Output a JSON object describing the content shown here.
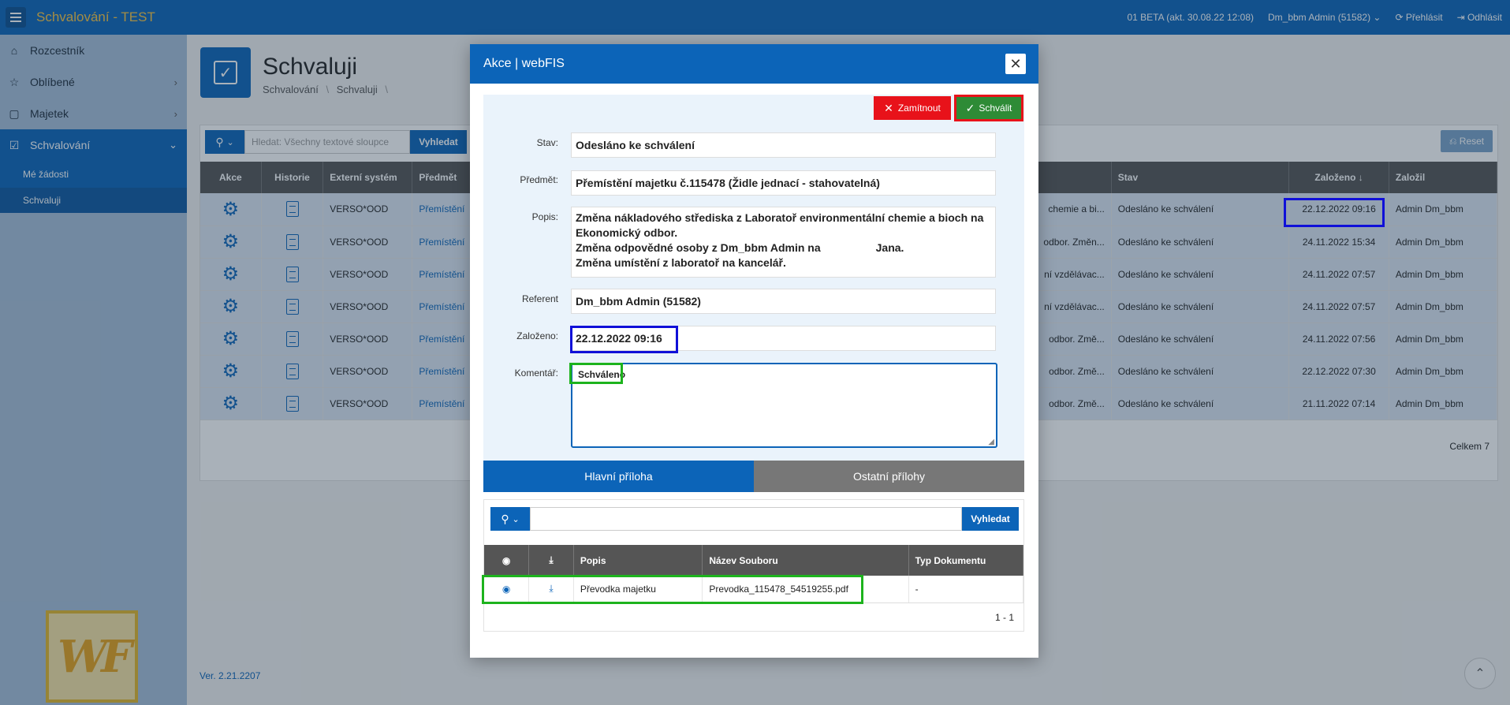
{
  "app": {
    "title": "Schvalování - TEST",
    "version_info": "01 BETA (akt. 30.08.22 12:08)",
    "user": "Dm_bbm Admin (51582)",
    "relogin": "Přehlásit",
    "logout": "Odhlásit"
  },
  "sidebar": {
    "items": [
      {
        "label": "Rozcestník",
        "icon": "home-icon"
      },
      {
        "label": "Oblíbené",
        "icon": "star-icon"
      },
      {
        "label": "Majetek",
        "icon": "box-icon"
      },
      {
        "label": "Schvalování",
        "icon": "checkbox-icon"
      }
    ],
    "subitems": [
      {
        "label": "Mé žádosti"
      },
      {
        "label": "Schvaluji"
      }
    ]
  },
  "page": {
    "title": "Schvaluji",
    "crumb1": "Schvalování",
    "crumb2": "Schvaluji",
    "sep": "\\"
  },
  "report": {
    "search_placeholder": "Hledat: Všechny textové sloupce",
    "search_button": "Vyhledat",
    "reset": "Reset",
    "columns": {
      "akce": "Akce",
      "historie": "Historie",
      "externi": "Externí systém",
      "predmet": "Předmět",
      "stav": "Stav",
      "zalozeno": "Založeno",
      "zalozil": "Založil"
    },
    "rows": [
      {
        "ext": "VERSO*OOD",
        "predmet": "Přemístění",
        "popis": "chemie a bi...",
        "stav": "Odesláno ke schválení",
        "datum": "22.12.2022 09:16",
        "autor": "Admin Dm_bbm"
      },
      {
        "ext": "VERSO*OOD",
        "predmet": "Přemístění",
        "popis": "odbor. Změn...",
        "stav": "Odesláno ke schválení",
        "datum": "24.11.2022 15:34",
        "autor": "Admin Dm_bbm"
      },
      {
        "ext": "VERSO*OOD",
        "predmet": "Přemístění",
        "popis": "ní vzdělávac...",
        "stav": "Odesláno ke schválení",
        "datum": "24.11.2022 07:57",
        "autor": "Admin Dm_bbm"
      },
      {
        "ext": "VERSO*OOD",
        "predmet": "Přemístění",
        "popis": "ní vzdělávac...",
        "stav": "Odesláno ke schválení",
        "datum": "24.11.2022 07:57",
        "autor": "Admin Dm_bbm"
      },
      {
        "ext": "VERSO*OOD",
        "predmet": "Přemístění",
        "popis": "odbor. Změ...",
        "stav": "Odesláno ke schválení",
        "datum": "24.11.2022 07:56",
        "autor": "Admin Dm_bbm"
      },
      {
        "ext": "VERSO*OOD",
        "predmet": "Přemístění",
        "popis": "odbor. Změ...",
        "stav": "Odesláno ke schválení",
        "datum": "22.12.2022 07:30",
        "autor": "Admin Dm_bbm"
      },
      {
        "ext": "VERSO*OOD",
        "predmet": "Přemístění",
        "popis": "odbor. Změ...",
        "stav": "Odesláno ke schválení",
        "datum": "21.11.2022 07:14",
        "autor": "Admin Dm_bbm"
      }
    ],
    "total": "Celkem 7"
  },
  "footer": {
    "version": "Ver. 2.21.2207"
  },
  "dialog": {
    "title": "Akce | webFIS",
    "reject": "Zamítnout",
    "approve": "Schválit",
    "labels": {
      "stav": "Stav:",
      "predmet": "Předmět:",
      "popis": "Popis:",
      "referent": "Referent",
      "zalozeno": "Založeno:",
      "komentar": "Komentář:"
    },
    "values": {
      "stav": "Odesláno ke schválení",
      "predmet": "Přemístění majetku č.115478 (Židle jednací - stahovatelná)",
      "popis1": "Změna nákladového střediska z Laboratoř environmentální chemie a bioch na Ekonomický odbor.",
      "popis2": "Změna odpovědné osoby z Dm_bbm Admin na                  Jana.",
      "popis3": "Změna umístění z laboratoř na kancelář.",
      "referent": "Dm_bbm Admin (51582)",
      "zalozeno": "22.12.2022 09:16",
      "komentar": "Schváleno"
    },
    "tabs": {
      "main": "Hlavní příloha",
      "other": "Ostatní přílohy"
    },
    "attachments": {
      "search_button": "Vyhledat",
      "columns": {
        "popis": "Popis",
        "nazev": "Název Souboru",
        "typ": "Typ Dokumentu"
      },
      "row": {
        "popis": "Převodka majetku",
        "nazev": "Prevodka_115478_54519255.pdf",
        "typ": "-"
      },
      "pagination": "1 - 1"
    }
  }
}
